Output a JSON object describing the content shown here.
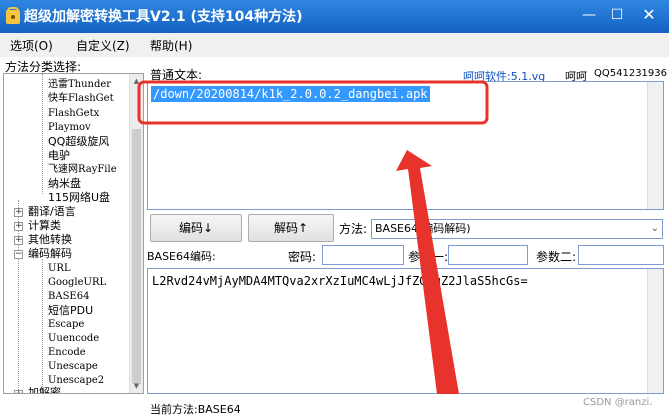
{
  "window": {
    "title": "超级加解密转换工具V2.1 (支持104种方法)",
    "minimize_glyph": "—",
    "maximize_glyph": "☐",
    "close_glyph": "✕"
  },
  "menu": {
    "items": [
      {
        "label": "选项(O)"
      },
      {
        "label": "自定义(Z)"
      },
      {
        "label": "帮助(H)"
      }
    ]
  },
  "sidebar": {
    "label": "方法分类选择:",
    "tree_top_items": [
      "迅雷Thunder",
      "快车FlashGet",
      "FlashGetx",
      "Playmov",
      "QQ超级旋风",
      "电驴",
      "飞速网RayFile",
      "纳米盘",
      "115网络U盘"
    ],
    "categories": [
      "翻译/语言",
      "计算类",
      "其他转换",
      "编码解码"
    ],
    "tree_sub_items": [
      "URL",
      "GoogleURL",
      "BASE64",
      "短信PDU",
      "Escape",
      "Uuencode",
      "Encode",
      "Unescape",
      "Unescape2"
    ],
    "tree_bottom_partial": "加解密"
  },
  "plain": {
    "label": "普通文本:",
    "value": "/down/20200814/k1k_2.0.0.2_dangbei.apk"
  },
  "credit": {
    "link": "呵呵软件:5.1.vg",
    "author": "呵呵",
    "qq": "QQ541231936"
  },
  "actions": {
    "encode": "编码↓",
    "decode": "解码↑",
    "method_label": "方法:",
    "method_value": "BASE64(编码解码)"
  },
  "params": {
    "b64_label": "BASE64编码:",
    "password_label": "密码:",
    "param1_label": "参数一:",
    "param2_label": "参数二:"
  },
  "output": {
    "value": "L2Rvd24vMjAyMDA4MTQva2xrXzIuMC4wLjJfZGFuZ2JlaS5hcGs="
  },
  "status": {
    "text": "当前方法:BASE64"
  },
  "watermark": "CSDN @ranzi.",
  "colors": {
    "title_bar": "#1a6fd6",
    "selection": "#3399ff",
    "annotation": "#e8332c",
    "link": "#0a4fc4"
  }
}
